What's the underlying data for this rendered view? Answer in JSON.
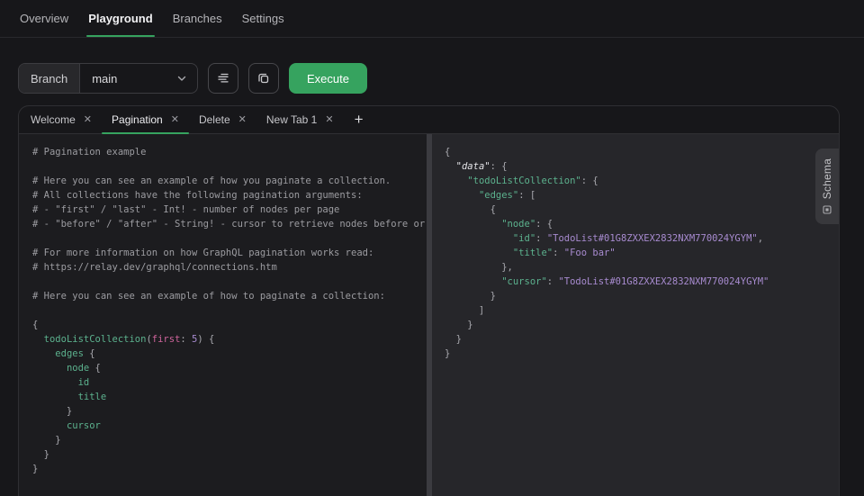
{
  "nav": {
    "items": [
      {
        "label": "Overview",
        "active": false
      },
      {
        "label": "Playground",
        "active": true
      },
      {
        "label": "Branches",
        "active": false
      },
      {
        "label": "Settings",
        "active": false
      }
    ]
  },
  "toolbar": {
    "branch_label": "Branch",
    "branch_value": "main",
    "execute_label": "Execute",
    "icons": [
      "chevron-down-icon",
      "prettify-icon",
      "copy-icon"
    ]
  },
  "tabs": {
    "items": [
      {
        "label": "Welcome",
        "active": false
      },
      {
        "label": "Pagination",
        "active": true
      },
      {
        "label": "Delete",
        "active": false
      },
      {
        "label": "New Tab 1",
        "active": false
      }
    ],
    "close_glyph": "✕",
    "add_label": "+"
  },
  "schema_panel": {
    "label": "Schema",
    "icon": "schema-icon"
  },
  "colors": {
    "accent_green": "#36a35f",
    "page_background": "#17171a",
    "editor_background": "#1c1c1f",
    "result_background": "#26262a",
    "code_green": "#5cb28e",
    "code_pink": "#cf649c",
    "code_purple": "#a88bd0",
    "code_comment": "#9c9ca1"
  },
  "editor": {
    "language": "graphql",
    "lines": [
      [
        {
          "t": "c",
          "s": "# Pagination example"
        }
      ],
      [],
      [
        {
          "t": "c",
          "s": "# Here you can see an example of how you paginate a collection."
        }
      ],
      [
        {
          "t": "c",
          "s": "# All collections have the following pagination arguments:"
        }
      ],
      [
        {
          "t": "c",
          "s": "# - \"first\" / \"last\" - Int! - number of nodes per page"
        }
      ],
      [
        {
          "t": "c",
          "s": "# - \"before\" / \"after\" - String! - cursor to retrieve nodes before or a"
        }
      ],
      [],
      [
        {
          "t": "c",
          "s": "# For more information on how GraphQL pagination works read:"
        }
      ],
      [
        {
          "t": "c",
          "s": "# https://relay.dev/graphql/connections.htm"
        }
      ],
      [],
      [
        {
          "t": "c",
          "s": "# Here you can see an example of how to paginate a collection:"
        }
      ],
      [],
      [
        {
          "t": "d",
          "s": "{"
        }
      ],
      [
        {
          "t": "d",
          "s": "  "
        },
        {
          "t": "g",
          "s": "todoListCollection"
        },
        {
          "t": "d",
          "s": "("
        },
        {
          "t": "p",
          "s": "first"
        },
        {
          "t": "d",
          "s": ": "
        },
        {
          "t": "v",
          "s": "5"
        },
        {
          "t": "d",
          "s": ") {"
        }
      ],
      [
        {
          "t": "d",
          "s": "    "
        },
        {
          "t": "g",
          "s": "edges"
        },
        {
          "t": "d",
          "s": " {"
        }
      ],
      [
        {
          "t": "d",
          "s": "      "
        },
        {
          "t": "g",
          "s": "node"
        },
        {
          "t": "d",
          "s": " {"
        }
      ],
      [
        {
          "t": "d",
          "s": "        "
        },
        {
          "t": "g",
          "s": "id"
        }
      ],
      [
        {
          "t": "d",
          "s": "        "
        },
        {
          "t": "g",
          "s": "title"
        }
      ],
      [
        {
          "t": "d",
          "s": "      }"
        }
      ],
      [
        {
          "t": "d",
          "s": "      "
        },
        {
          "t": "g",
          "s": "cursor"
        }
      ],
      [
        {
          "t": "d",
          "s": "    }"
        }
      ],
      [
        {
          "t": "d",
          "s": "  }"
        }
      ],
      [
        {
          "t": "d",
          "s": "}"
        }
      ]
    ]
  },
  "result": {
    "language": "json",
    "lines": [
      [
        {
          "t": "d",
          "s": "{"
        }
      ],
      [
        {
          "t": "d",
          "s": "  "
        },
        {
          "t": "i",
          "s": "\"data\""
        },
        {
          "t": "d",
          "s": ": {"
        }
      ],
      [
        {
          "t": "d",
          "s": "    "
        },
        {
          "t": "g",
          "s": "\"todoListCollection\""
        },
        {
          "t": "d",
          "s": ": {"
        }
      ],
      [
        {
          "t": "d",
          "s": "      "
        },
        {
          "t": "g",
          "s": "\"edges\""
        },
        {
          "t": "d",
          "s": ": ["
        }
      ],
      [
        {
          "t": "d",
          "s": "        {"
        }
      ],
      [
        {
          "t": "d",
          "s": "          "
        },
        {
          "t": "g",
          "s": "\"node\""
        },
        {
          "t": "d",
          "s": ": {"
        }
      ],
      [
        {
          "t": "d",
          "s": "            "
        },
        {
          "t": "g",
          "s": "\"id\""
        },
        {
          "t": "d",
          "s": ": "
        },
        {
          "t": "v",
          "s": "\"TodoList#01G8ZXXEX2832NXM770024YGYM\""
        },
        {
          "t": "d",
          "s": ","
        }
      ],
      [
        {
          "t": "d",
          "s": "            "
        },
        {
          "t": "g",
          "s": "\"title\""
        },
        {
          "t": "d",
          "s": ": "
        },
        {
          "t": "v",
          "s": "\"Foo bar\""
        }
      ],
      [
        {
          "t": "d",
          "s": "          },"
        }
      ],
      [
        {
          "t": "d",
          "s": "          "
        },
        {
          "t": "g",
          "s": "\"cursor\""
        },
        {
          "t": "d",
          "s": ": "
        },
        {
          "t": "v",
          "s": "\"TodoList#01G8ZXXEX2832NXM770024YGYM\""
        }
      ],
      [
        {
          "t": "d",
          "s": "        }"
        }
      ],
      [
        {
          "t": "d",
          "s": "      ]"
        }
      ],
      [
        {
          "t": "d",
          "s": "    }"
        }
      ],
      [
        {
          "t": "d",
          "s": "  }"
        }
      ],
      [
        {
          "t": "d",
          "s": "}"
        }
      ]
    ]
  }
}
